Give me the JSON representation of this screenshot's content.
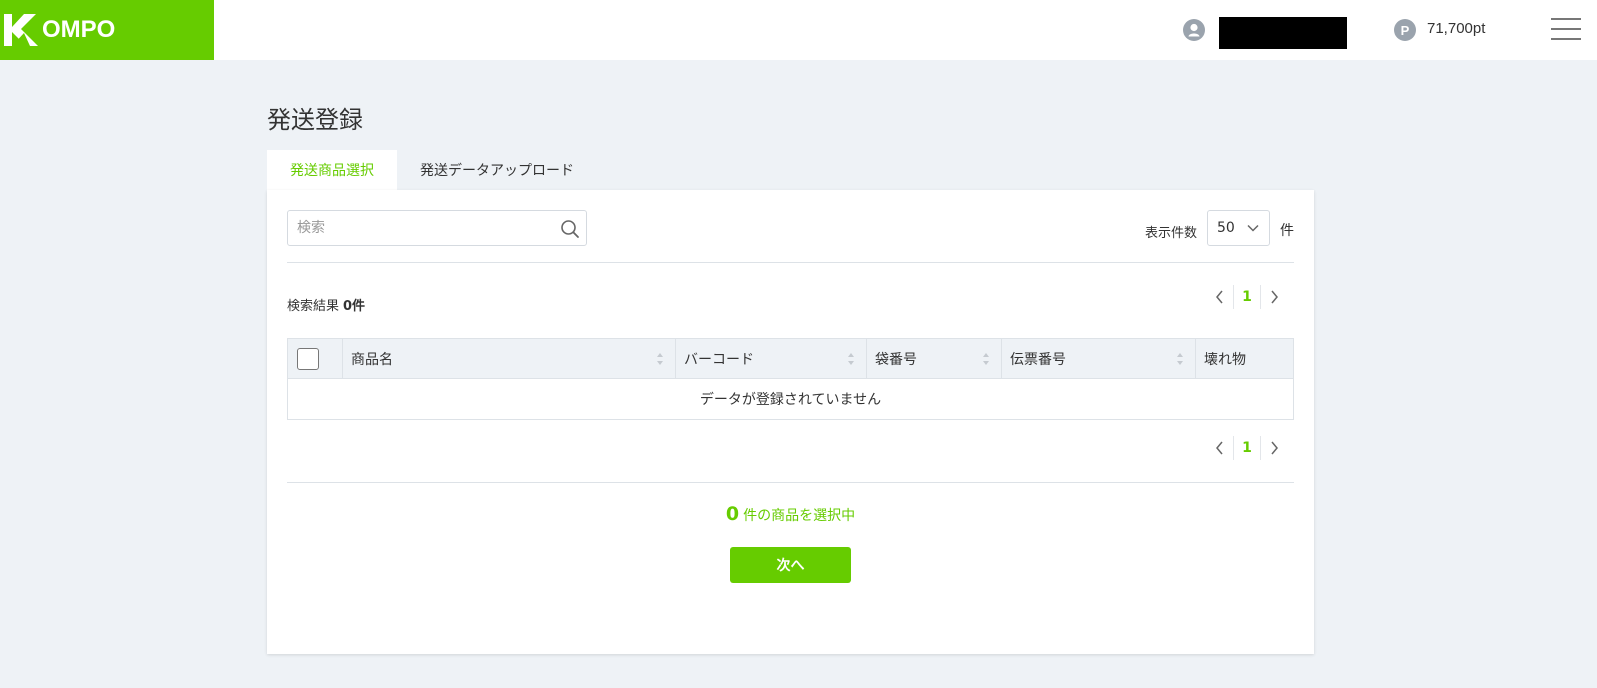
{
  "header": {
    "logo_text": "OMPO",
    "points_icon": "P",
    "points": "71,700pt"
  },
  "page": {
    "title": "発送登録"
  },
  "tabs": [
    {
      "label": "発送商品選択",
      "active": true
    },
    {
      "label": "発送データアップロード",
      "active": false
    }
  ],
  "search": {
    "placeholder": "検索",
    "value": ""
  },
  "per_page": {
    "label": "表示件数",
    "value": "50",
    "unit": "件"
  },
  "results": {
    "label": "検索結果",
    "count": "0件"
  },
  "pagination": {
    "current_page": "1"
  },
  "table": {
    "columns": [
      "商品名",
      "バーコード",
      "袋番号",
      "伝票番号",
      "壊れ物"
    ],
    "empty_message": "データが登録されていません"
  },
  "selection": {
    "count": "0",
    "text": "件の商品を選択中"
  },
  "actions": {
    "next_label": "次へ"
  },
  "colors": {
    "brand": "#66cc00",
    "background": "#eef2f6"
  }
}
